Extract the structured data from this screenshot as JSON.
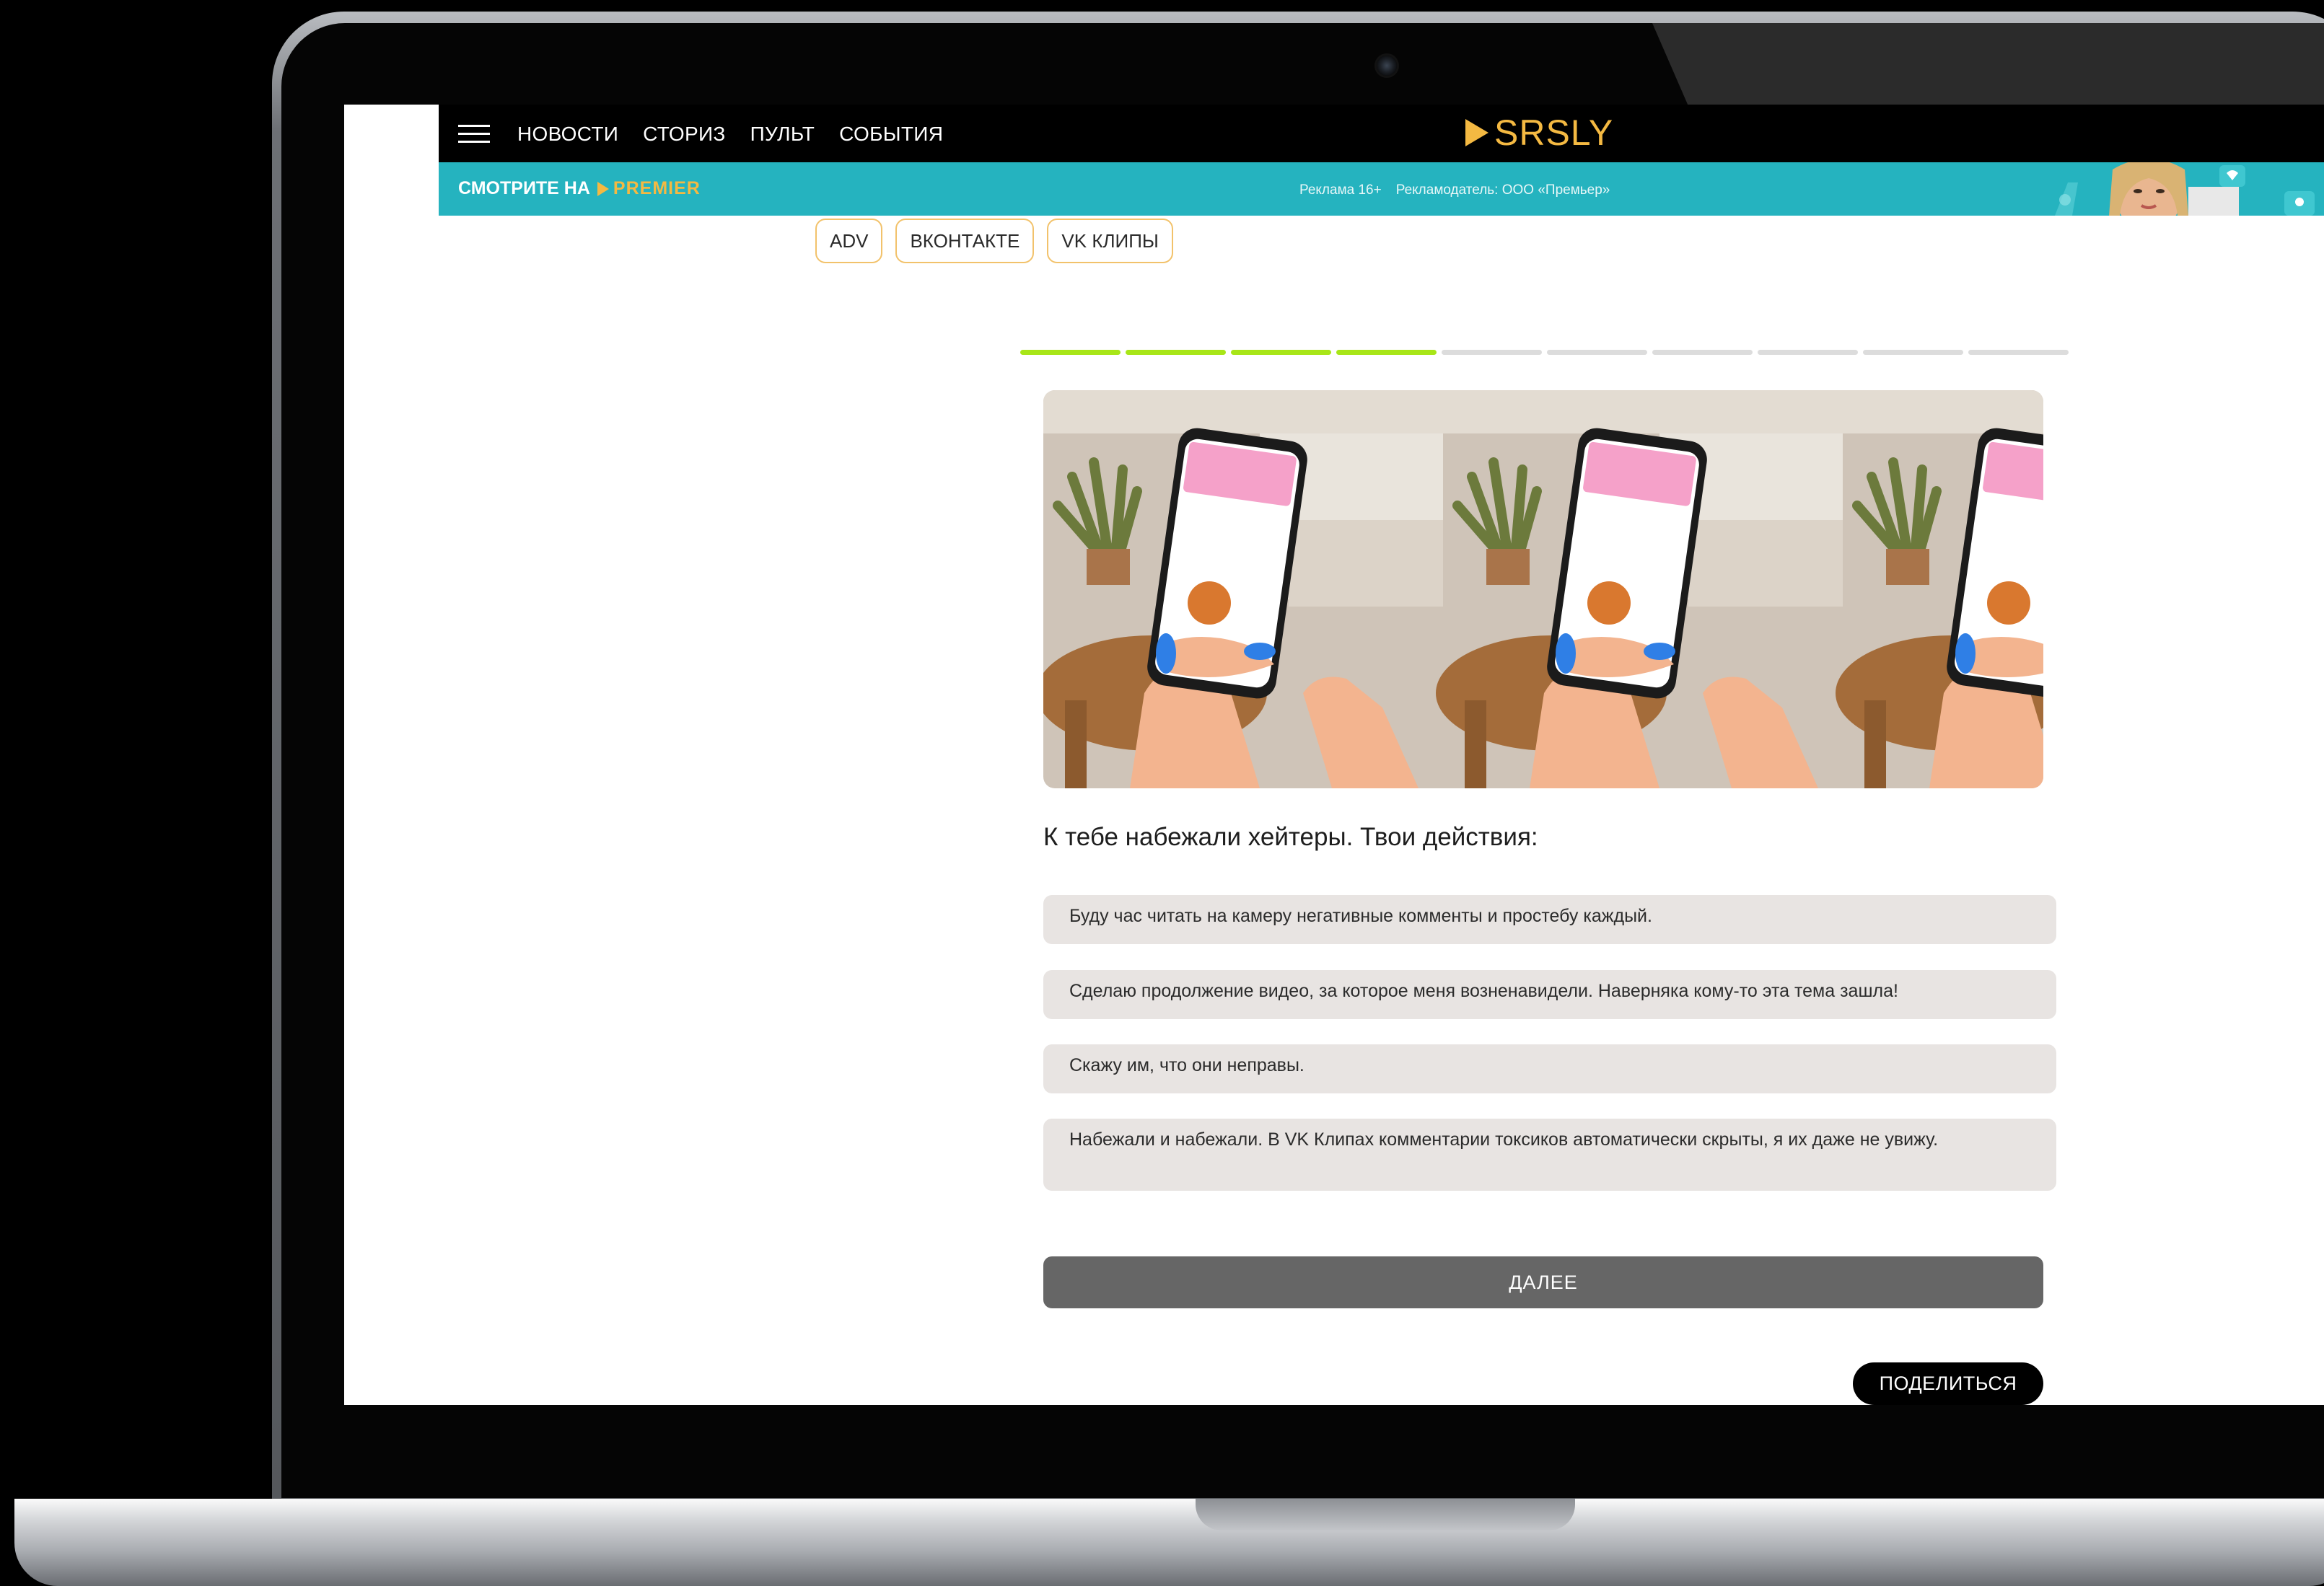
{
  "header": {
    "nav": [
      "НОВОСТИ",
      "СТОРИЗ",
      "ПУЛЬТ",
      "СОБЫТИЯ"
    ],
    "logo": "SRSLY"
  },
  "ad_banner": {
    "watch_text": "СМОТРИТЕ НА",
    "brand": "PREMIER",
    "age_label": "Реклама 16+",
    "advertiser": "Рекламодатель: ООО «Премьер»"
  },
  "tags": [
    "ADV",
    "ВКОНТАКТЕ",
    "VK КЛИПЫ"
  ],
  "quiz": {
    "progress": {
      "completed": 4,
      "total": 10
    },
    "question": "К тебе набежали хейтеры. Твои действия:",
    "answers": [
      "Буду час читать на камеру негативные комменты и простебу каждый.",
      "Сделаю продолжение видео, за которое меня возненавидели. Наверняка кому-то эта тема зашла!",
      "Скажу им, что они неправы.",
      "Набежали и набежали. В VK Клипах комментарии токсиков автоматически скрыты, я их даже не увижу."
    ],
    "next_label": "ДАЛЕЕ",
    "share_label": "ПОДЕЛИТЬСЯ"
  },
  "colors": {
    "accent_yellow": "#f4b942",
    "banner_teal": "#25b3bf",
    "progress_active": "#a8e618",
    "progress_inactive": "#dcdcdc",
    "answer_bg": "#e8e4e2",
    "next_button": "#666666"
  }
}
